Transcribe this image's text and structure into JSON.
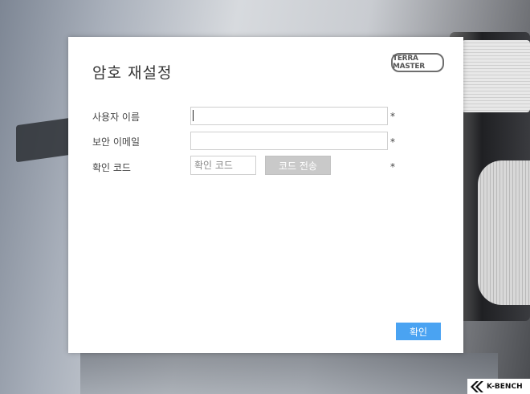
{
  "dialog": {
    "title": "암호 재설정",
    "logo_text": "TERRA MASTER",
    "fields": {
      "username": {
        "label": "사용자 이름",
        "value": "",
        "required_mark": "*"
      },
      "email": {
        "label": "보안 이메일",
        "value": "",
        "required_mark": "*"
      },
      "code": {
        "label": "확인 코드",
        "placeholder": "확인 코드",
        "required_mark": "*"
      }
    },
    "send_code_button": "코드 전송",
    "confirm_button": "확인"
  },
  "watermark": {
    "text": "K-BENCH"
  },
  "colors": {
    "primary_button": "#4aa3f2",
    "disabled_button": "#c9c9c9",
    "dialog_background": "#ffffff"
  }
}
